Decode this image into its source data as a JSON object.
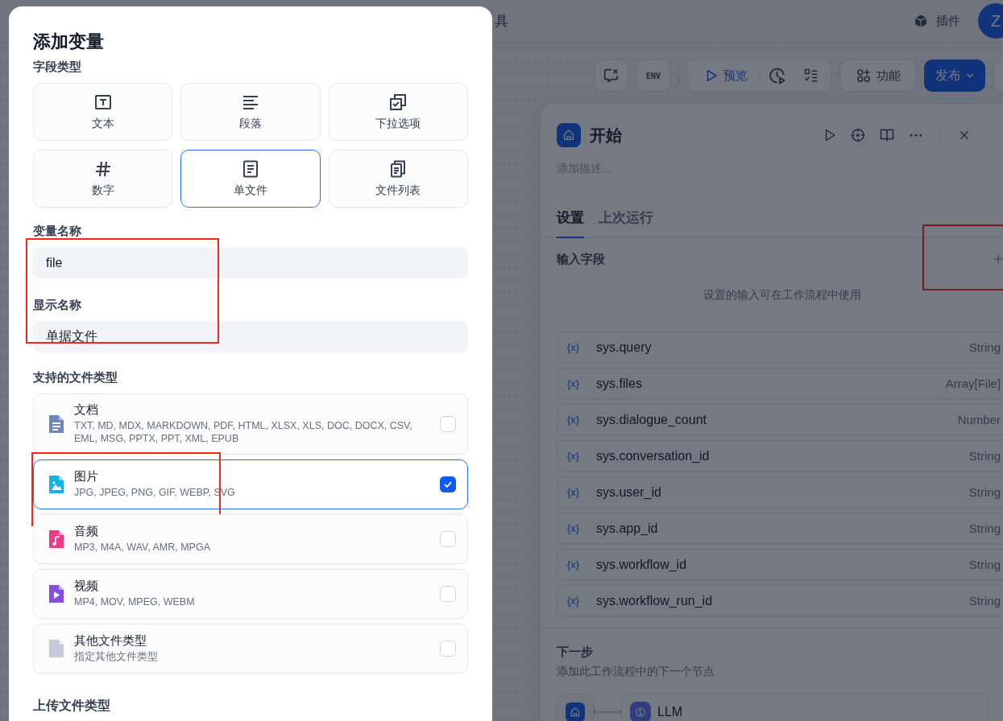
{
  "topbar": {
    "menu_fragment": "具",
    "plugins_label": "插件",
    "avatar": "Z"
  },
  "toolbar": {
    "env_label": "ENV",
    "preview_label": "预览",
    "features_label": "功能",
    "publish_label": "发布"
  },
  "start_panel": {
    "title": "开始",
    "description_placeholder": "添加描述...",
    "tabs": [
      {
        "label": "设置",
        "selected": true
      },
      {
        "label": "上次运行",
        "selected": false
      }
    ],
    "input_section": {
      "title": "输入字段",
      "highlighted": true,
      "hint": "设置的输入可在工作流程中使用"
    },
    "variables": [
      {
        "icon": "{x}",
        "name": "sys.query",
        "type": "String"
      },
      {
        "icon": "{x}",
        "name": "sys.files",
        "type": "Array[File]"
      },
      {
        "icon": "{x}",
        "name": "sys.dialogue_count",
        "type": "Number"
      },
      {
        "icon": "{x}",
        "name": "sys.conversation_id",
        "type": "String"
      },
      {
        "icon": "{x}",
        "name": "sys.user_id",
        "type": "String"
      },
      {
        "icon": "{x}",
        "name": "sys.app_id",
        "type": "String"
      },
      {
        "icon": "{x}",
        "name": "sys.workflow_id",
        "type": "String"
      },
      {
        "icon": "{x}",
        "name": "sys.workflow_run_id",
        "type": "String"
      }
    ],
    "next_step": {
      "title": "下一步",
      "description": "添加此工作流程中的下一个节点",
      "node": "LLM"
    }
  },
  "modal": {
    "title": "添加变量",
    "field_type_label": "字段类型",
    "field_types": [
      {
        "kind": "text",
        "label": "文本",
        "selected": false
      },
      {
        "kind": "paragraph",
        "label": "段落",
        "selected": false
      },
      {
        "kind": "select",
        "label": "下拉选项",
        "selected": false
      },
      {
        "kind": "number",
        "label": "数字",
        "selected": false
      },
      {
        "kind": "file",
        "label": "单文件",
        "selected": true
      },
      {
        "kind": "file-list",
        "label": "文件列表",
        "selected": false
      }
    ],
    "name_fields": {
      "highlighted": true,
      "variable_name_label": "变量名称",
      "variable_name": "file",
      "display_name_label": "显示名称",
      "display_name": "单据文件"
    },
    "file_types_label": "支持的文件类型",
    "file_types": [
      {
        "kind": "document",
        "name": "文档",
        "extensions": "TXT, MD, MDX, MARKDOWN, PDF, HTML, XLSX, XLS, DOC, DOCX, CSV, EML, MSG, PPTX, PPT, XML, EPUB",
        "checked": false,
        "highlighted": false
      },
      {
        "kind": "image",
        "name": "图片",
        "extensions": "JPG, JPEG, PNG, GIF, WEBP, SVG",
        "checked": true,
        "highlighted": true
      },
      {
        "kind": "audio",
        "name": "音频",
        "extensions": "MP3, M4A, WAV, AMR, MPGA",
        "checked": false,
        "highlighted": false
      },
      {
        "kind": "video",
        "name": "视频",
        "extensions": "MP4, MOV, MPEG, WEBM",
        "checked": false,
        "highlighted": false
      },
      {
        "kind": "other",
        "name": "其他文件类型",
        "extensions": "指定其他文件类型",
        "checked": false,
        "highlighted": false
      }
    ],
    "upload_label": "上传文件类型"
  }
}
